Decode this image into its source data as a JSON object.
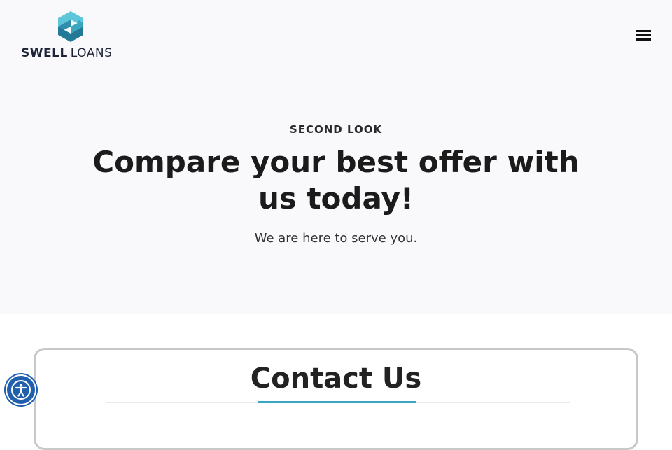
{
  "brand": {
    "name_bold": "SWELL",
    "name_light": "LOANS",
    "logo_icon": "hexagon-s-logo-icon",
    "colors": {
      "logo_teal": "#3aa6bf",
      "logo_navy": "#1d2438"
    }
  },
  "header": {
    "menu_icon": "hamburger-menu-icon"
  },
  "hero": {
    "eyebrow": "SECOND LOOK",
    "title": "Compare your best offer with us today!",
    "subtitle": "We are here to serve you."
  },
  "contact": {
    "title": "Contact Us",
    "accent_color": "#3aa6bf"
  },
  "accessibility": {
    "icon": "accessibility-icon",
    "color": "#1f5fae"
  }
}
